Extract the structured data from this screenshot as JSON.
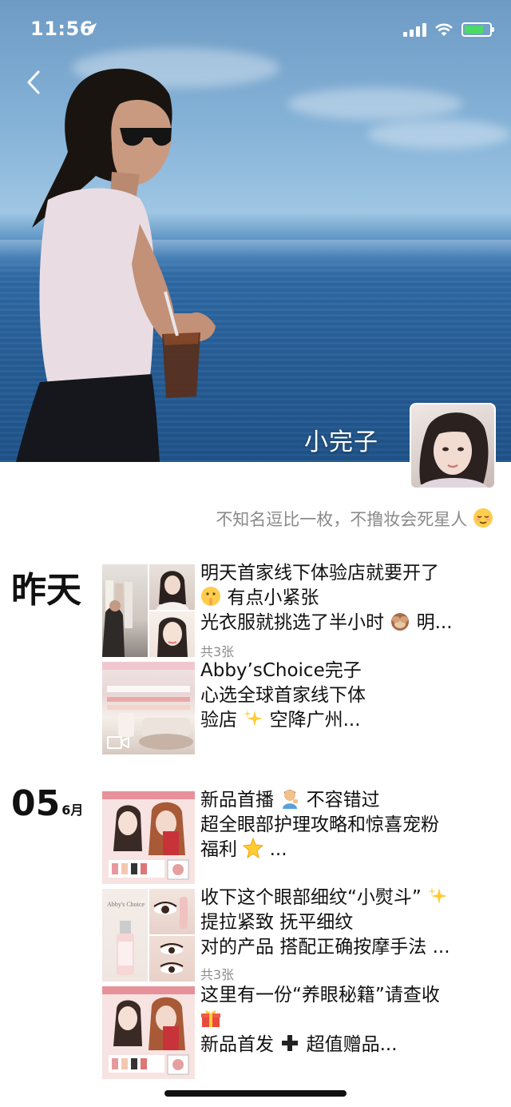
{
  "status": {
    "time": "11:56"
  },
  "cover": {
    "name": "小完子"
  },
  "profile": {
    "signature": "不知名逗比一枚，不撸妆会死星人"
  },
  "days": [
    {
      "label": "昨天",
      "posts": [
        {
          "lines": [
            "明天首家线下体验店就要开了",
            "有点小紧张",
            "光衣服就挑选了半小时",
            "明..."
          ],
          "count": "共3张"
        },
        {
          "lines": [
            "Abby’sChoice完子",
            "心选全球首家线下体",
            "验店",
            "空降广州..."
          ],
          "count": ""
        }
      ]
    },
    {
      "day": "05",
      "month": "6月",
      "posts": [
        {
          "lines": [
            "新品首播",
            "不容错过",
            "超全眼部护理攻略和惊喜宠粉",
            "福利",
            "..."
          ],
          "count": ""
        },
        {
          "lines": [
            "收下这个眼部细纹“小熨斗”",
            "提拉紧致 抚平细纹",
            "对的产品 搭配正确按摩手法 ..."
          ],
          "count": "共3张"
        },
        {
          "lines": [
            "这里有一份“养眼秘籍”请查收",
            "新品首发",
            "超值赠品..."
          ],
          "count": ""
        }
      ]
    }
  ],
  "thumb_labels": {
    "brand": "Abby's Choice"
  }
}
